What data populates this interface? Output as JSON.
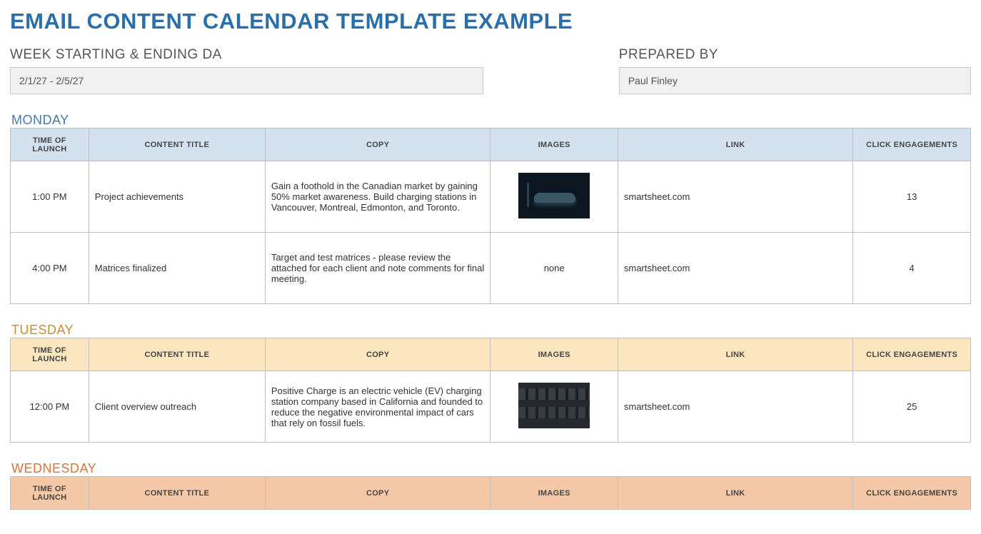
{
  "title": "EMAIL CONTENT CALENDAR TEMPLATE EXAMPLE",
  "meta": {
    "week_label": "WEEK STARTING & ENDING DA",
    "week_value": "2/1/27 - 2/5/27",
    "prepared_label": "PREPARED BY",
    "prepared_value": "Paul Finley"
  },
  "columns": {
    "time": "TIME OF LAUNCH",
    "title": "CONTENT TITLE",
    "copy": "COPY",
    "images": "IMAGES",
    "link": "LINK",
    "clicks": "CLICK ENGAGEMENTS"
  },
  "days": [
    {
      "key": "monday",
      "label": "MONDAY",
      "rows": [
        {
          "time": "1:00 PM",
          "title": "Project achievements",
          "copy": "Gain a foothold in the Canadian market by gaining 50% market awareness. Build charging stations in Vancouver, Montreal, Edmonton, and Toronto.",
          "image": "car",
          "link": "smartsheet.com",
          "clicks": "13"
        },
        {
          "time": "4:00 PM",
          "title": "Matrices finalized",
          "copy": "Target and test matrices - please review the attached for each client and note comments for final meeting.",
          "image": "none",
          "link": "smartsheet.com",
          "clicks": "4"
        }
      ]
    },
    {
      "key": "tuesday",
      "label": "TUESDAY",
      "rows": [
        {
          "time": "12:00 PM",
          "title": "Client overview outreach",
          "copy": "Positive Charge is an electric vehicle (EV) charging station company based in California and founded to reduce the negative environmental impact of cars that rely on fossil fuels.",
          "image": "traffic",
          "link": "smartsheet.com",
          "clicks": "25"
        }
      ]
    },
    {
      "key": "wednesday",
      "label": "WEDNESDAY",
      "rows": []
    }
  ]
}
